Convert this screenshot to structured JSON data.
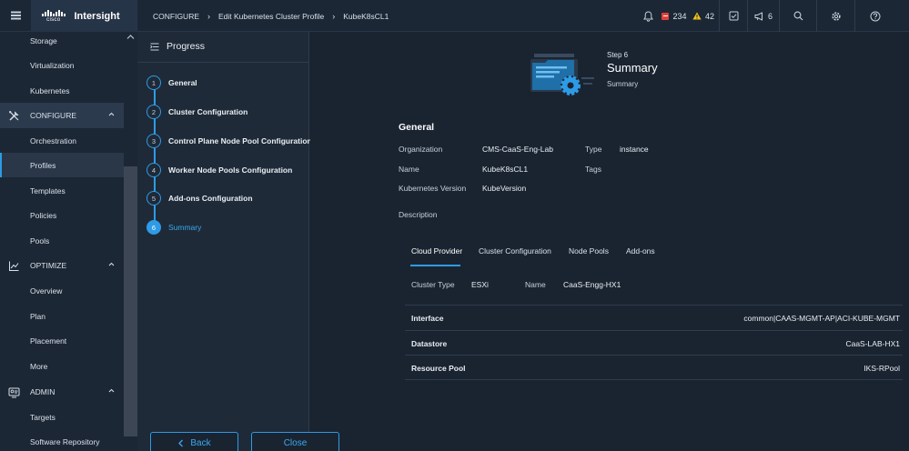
{
  "brand": {
    "logo_text": "cisco",
    "name": "Intersight"
  },
  "breadcrumb": [
    "CONFIGURE",
    "Edit Kubernetes Cluster Profile",
    "KubeK8sCL1"
  ],
  "topbar": {
    "critical_count": "234",
    "warning_count": "42",
    "announce_count": "6"
  },
  "sidebar": {
    "items_top": [
      "Storage",
      "Virtualization",
      "Kubernetes"
    ],
    "configure": {
      "label": "CONFIGURE",
      "items": [
        "Orchestration",
        "Profiles",
        "Templates",
        "Policies",
        "Pools"
      ]
    },
    "optimize": {
      "label": "OPTIMIZE",
      "items": [
        "Overview",
        "Plan",
        "Placement",
        "More"
      ]
    },
    "admin": {
      "label": "ADMIN",
      "items": [
        "Targets",
        "Software Repository"
      ]
    }
  },
  "progress": {
    "title": "Progress",
    "steps": [
      {
        "num": "1",
        "label": "General"
      },
      {
        "num": "2",
        "label": "Cluster Configuration"
      },
      {
        "num": "3",
        "label": "Control Plane Node Pool Configuration"
      },
      {
        "num": "4",
        "label": "Worker Node Pools Configuration"
      },
      {
        "num": "5",
        "label": "Add-ons Configuration"
      },
      {
        "num": "6",
        "label": "Summary"
      }
    ]
  },
  "header": {
    "step": "Step 6",
    "title": "Summary",
    "subtitle": "Summary"
  },
  "general": {
    "title": "General",
    "organization_label": "Organization",
    "organization": "CMS-CaaS-Eng-Lab",
    "type_label": "Type",
    "type": "instance",
    "name_label": "Name",
    "name": "KubeK8sCL1",
    "tags_label": "Tags",
    "version_label": "Kubernetes Version",
    "version": "KubeVersion",
    "description_label": "Description"
  },
  "tabs": [
    "Cloud Provider",
    "Cluster Configuration",
    "Node Pools",
    "Add-ons"
  ],
  "cloud": {
    "cluster_type_label": "Cluster Type",
    "cluster_type": "ESXi",
    "name_label": "Name",
    "name": "CaaS-Engg-HX1",
    "rows": [
      {
        "key": "Interface",
        "value": "common|CAAS-MGMT-AP|ACI-KUBE-MGMT"
      },
      {
        "key": "Datastore",
        "value": "CaaS-LAB-HX1"
      },
      {
        "key": "Resource Pool",
        "value": "IKS-RPool"
      }
    ]
  },
  "footer": {
    "back": "Back",
    "close": "Close"
  },
  "colors": {
    "accent": "#2e9be6",
    "critical": "#e0403a",
    "warning": "#f2c318"
  }
}
